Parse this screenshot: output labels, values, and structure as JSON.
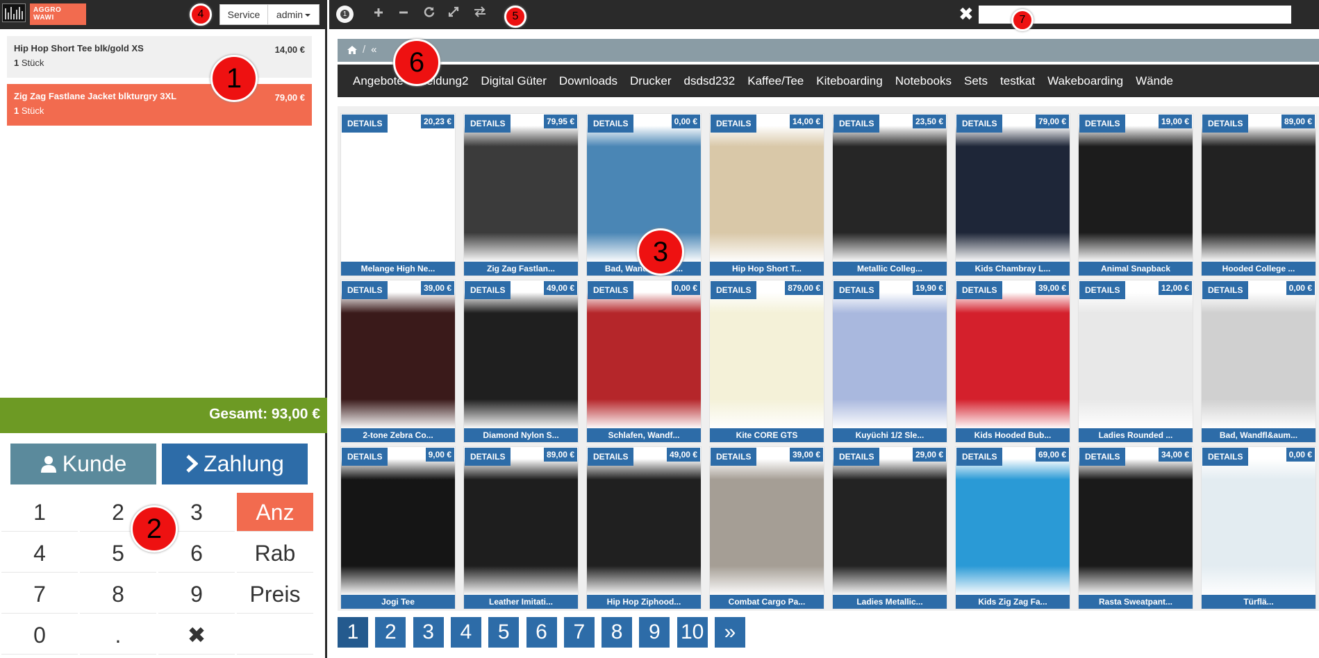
{
  "header": {
    "brand_line1": "AGGRO",
    "brand_line2": "WAWI",
    "service_label": "Service",
    "user_label": "admin"
  },
  "order_items": [
    {
      "name": "Hip Hop Short Tee blk/gold XS",
      "price": "14,00 €",
      "qty": "1",
      "unit": "Stück"
    },
    {
      "name": "Zig Zag Fastlane Jacket blkturgry 3XL",
      "price": "79,00 €",
      "qty": "1",
      "unit": "Stück"
    }
  ],
  "total": "Gesamt: 93,00 €",
  "actions": {
    "customer": "Kunde",
    "payment": "Zahlung"
  },
  "keypad": [
    "1",
    "2",
    "3",
    "Anz",
    "4",
    "5",
    "6",
    "Rab",
    "7",
    "8",
    "9",
    "Preis",
    "0",
    ".",
    "✖",
    ""
  ],
  "toolbar": {
    "tab_number": "1"
  },
  "search": {
    "placeholder": ""
  },
  "breadcrumb": {
    "back": "«"
  },
  "categories": [
    "Angebote",
    "Kleidung2",
    "Digital Güter",
    "Downloads",
    "Drucker",
    "dsdsd232",
    "Kaffee/Tee",
    "Kiteboarding",
    "Notebooks",
    "Sets",
    "testkat",
    "Wakeboarding",
    "Wände"
  ],
  "products": [
    {
      "title": "Melange High Ne...",
      "price": "20,23 €",
      "details": "DETAILS",
      "bg": "#ffffff"
    },
    {
      "title": "Zig Zag Fastlan...",
      "price": "79,95 €",
      "details": "DETAILS",
      "bg": "#3b3b3b"
    },
    {
      "title": "Bad, Wandfl&aum...",
      "price": "0,00 €",
      "details": "DETAILS",
      "bg": "#4a86b5"
    },
    {
      "title": "Hip Hop Short T...",
      "price": "14,00 €",
      "details": "DETAILS",
      "bg": "#d9c8a8"
    },
    {
      "title": "Metallic Colleg...",
      "price": "23,50 €",
      "details": "DETAILS",
      "bg": "#262626"
    },
    {
      "title": "Kids Chambray L...",
      "price": "79,00 €",
      "details": "DETAILS",
      "bg": "#1e2638"
    },
    {
      "title": "Animal Snapback",
      "price": "19,00 €",
      "details": "DETAILS",
      "bg": "#1c1c1c"
    },
    {
      "title": "Hooded College ...",
      "price": "89,00 €",
      "details": "DETAILS",
      "bg": "#222222"
    },
    {
      "title": "2-tone Zebra Co...",
      "price": "39,00 €",
      "details": "DETAILS",
      "bg": "#3a1a1a"
    },
    {
      "title": "Diamond Nylon S...",
      "price": "49,00 €",
      "details": "DETAILS",
      "bg": "#1f1f1f"
    },
    {
      "title": "Schlafen, Wandf...",
      "price": "0,00 €",
      "details": "DETAILS",
      "bg": "#b5262a"
    },
    {
      "title": "Kite CORE GTS",
      "price": "879,00 €",
      "details": "DETAILS",
      "bg": "#f4f1d8"
    },
    {
      "title": "Kuyüchi 1/2 Sle...",
      "price": "19,90 €",
      "details": "DETAILS",
      "bg": "#a9b8de"
    },
    {
      "title": "Kids Hooded Bub...",
      "price": "39,00 €",
      "details": "DETAILS",
      "bg": "#d4202c"
    },
    {
      "title": "Ladies Rounded ...",
      "price": "12,00 €",
      "details": "DETAILS",
      "bg": "#e8e8e8"
    },
    {
      "title": "Bad, Wandfl&aum...",
      "price": "0,00 €",
      "details": "DETAILS",
      "bg": "#d0d0d0"
    },
    {
      "title": "Jogi Tee",
      "price": "9,00 €",
      "details": "DETAILS",
      "bg": "#151515"
    },
    {
      "title": "Leather Imitati...",
      "price": "89,00 €",
      "details": "DETAILS",
      "bg": "#1e1e1e"
    },
    {
      "title": "Hip Hop Ziphood...",
      "price": "49,00 €",
      "details": "DETAILS",
      "bg": "#202020"
    },
    {
      "title": "Combat Cargo Pa...",
      "price": "39,00 €",
      "details": "DETAILS",
      "bg": "#a59e95"
    },
    {
      "title": "Ladies Metallic...",
      "price": "29,00 €",
      "details": "DETAILS",
      "bg": "#232323"
    },
    {
      "title": "Kids Zig Zag Fa...",
      "price": "69,00 €",
      "details": "DETAILS",
      "bg": "#2a9ad6"
    },
    {
      "title": "Rasta Sweatpant...",
      "price": "34,00 €",
      "details": "DETAILS",
      "bg": "#1a1a1a"
    },
    {
      "title": "Türflä...",
      "price": "0,00 €",
      "details": "DETAILS",
      "bg": "#e3ecf1"
    }
  ],
  "pagination": [
    "1",
    "2",
    "3",
    "4",
    "5",
    "6",
    "7",
    "8",
    "9",
    "10",
    "»"
  ],
  "callouts": [
    "1",
    "2",
    "3",
    "4",
    "5",
    "6",
    "7"
  ]
}
